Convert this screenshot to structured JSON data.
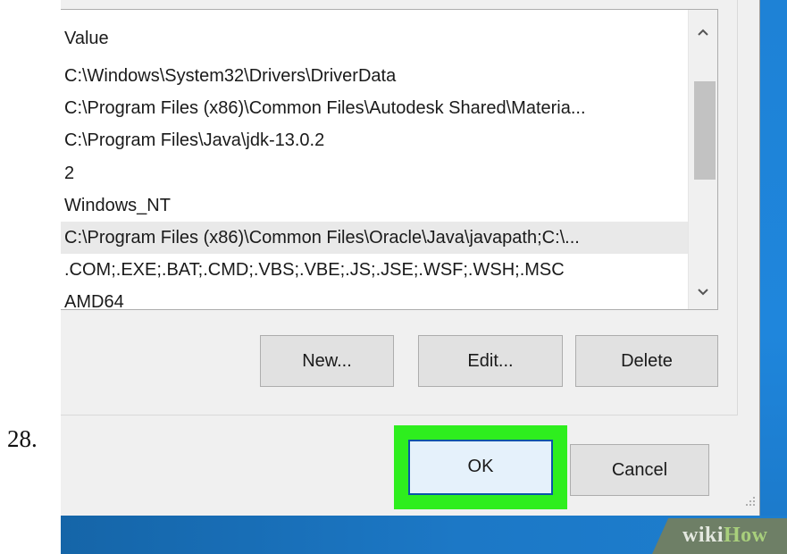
{
  "step": {
    "number": "28."
  },
  "variables_list": {
    "header": "Value",
    "values": [
      "C:\\Windows\\System32\\Drivers\\DriverData",
      "C:\\Program Files (x86)\\Common Files\\Autodesk Shared\\Materia...",
      "C:\\Program Files\\Java\\jdk-13.0.2",
      "2",
      "Windows_NT",
      "C:\\Program Files (x86)\\Common Files\\Oracle\\Java\\javapath;C:\\...",
      ".COM;.EXE;.BAT;.CMD;.VBS;.VBE;.JS;.JSE;.WSF;.WSH;.MSC",
      "AMD64"
    ],
    "selected_index": 5
  },
  "scrollbar": {
    "up_icon": "chevron-up-icon",
    "down_icon": "chevron-down-icon"
  },
  "buttons": {
    "new": "New...",
    "edit": "Edit...",
    "delete": "Delete",
    "ok": "OK",
    "cancel": "Cancel"
  },
  "branding": {
    "wiki": "wiki",
    "how": "How"
  },
  "colors": {
    "highlight": "#2eee1e",
    "ok_focus_border": "#0a55a8",
    "desktop_blue": "#1c78c6"
  }
}
